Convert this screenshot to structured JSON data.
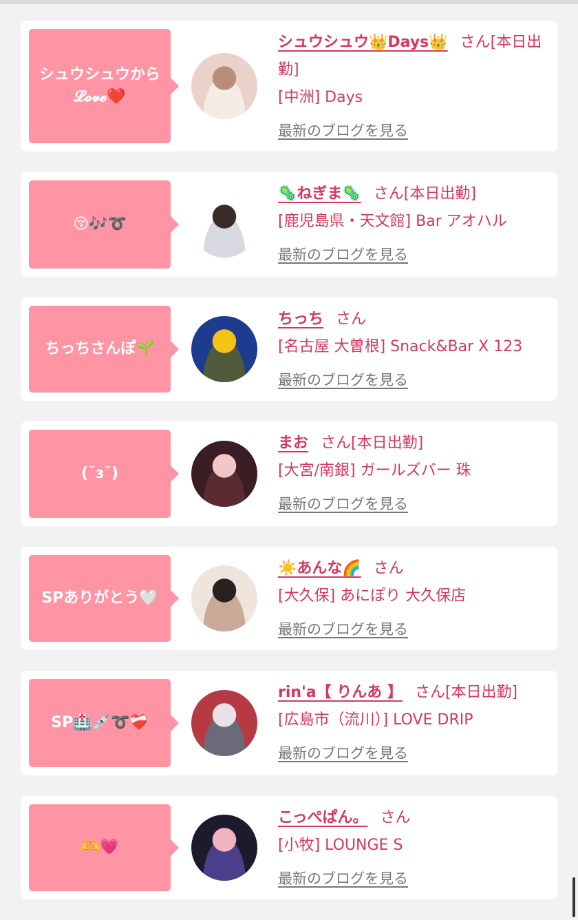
{
  "cards": [
    {
      "bubble": "シュウシュウから𝓛𝓸𝓿𝓮❤️",
      "name": "シュウシュウ👑Days👑",
      "suffix": "さん[本日出勤]",
      "shop": "[中洲] Days",
      "blog": "最新のブログを見る",
      "avatar_colors": [
        "#e8d2c9",
        "#b98d7a",
        "#f6ece6"
      ]
    },
    {
      "bubble": "😚🎶➰",
      "name": "🦠ねぎま🦠",
      "suffix": "さん[本日出勤]",
      "shop": "[鹿児島県・天文館] Bar アオハル",
      "blog": "最新のブログを見る",
      "avatar_colors": [
        "#ffffff",
        "#3b2a2a",
        "#d8d8e0"
      ]
    },
    {
      "bubble": "ちっちさんぽ🌱",
      "name": "ちっち",
      "suffix": "さん",
      "shop": "[名古屋 大曽根] Snack&Bar X 123",
      "blog": "最新のブログを見る",
      "avatar_colors": [
        "#1d3b8f",
        "#f3c316",
        "#4e5a3a"
      ]
    },
    {
      "bubble": "(˘ɜ˘)",
      "name": "まお",
      "suffix": "さん[本日出勤]",
      "shop": "[大宮/南銀] ガールズバー 珠",
      "blog": "最新のブログを見る",
      "avatar_colors": [
        "#3a1e23",
        "#f1c7c7",
        "#5a2b33"
      ]
    },
    {
      "bubble": "SPありがとう🤍",
      "name": "☀️あんな🌈",
      "suffix": "さん",
      "shop": "[大久保] あにぽり 大久保店",
      "blog": "最新のブログを見る",
      "avatar_colors": [
        "#efe5dd",
        "#2a2020",
        "#c9aa98"
      ]
    },
    {
      "bubble": "SP🏥💉➰❤️‍🩹",
      "name": "rin'a【 りんあ 】",
      "suffix": "さん[本日出勤]",
      "shop": "[広島市（流川）] LOVE DRIP",
      "blog": "最新のブログを見る",
      "avatar_colors": [
        "#b53a44",
        "#e8e2e6",
        "#6a6a78"
      ]
    },
    {
      "bubble": "🫶💗",
      "name": "こっぺぱん。",
      "suffix": "さん",
      "shop": "[小牧] LOUNGE S",
      "blog": "最新のブログを見る",
      "avatar_colors": [
        "#1d1a2b",
        "#f1b3c0",
        "#4a3f8a"
      ]
    }
  ]
}
